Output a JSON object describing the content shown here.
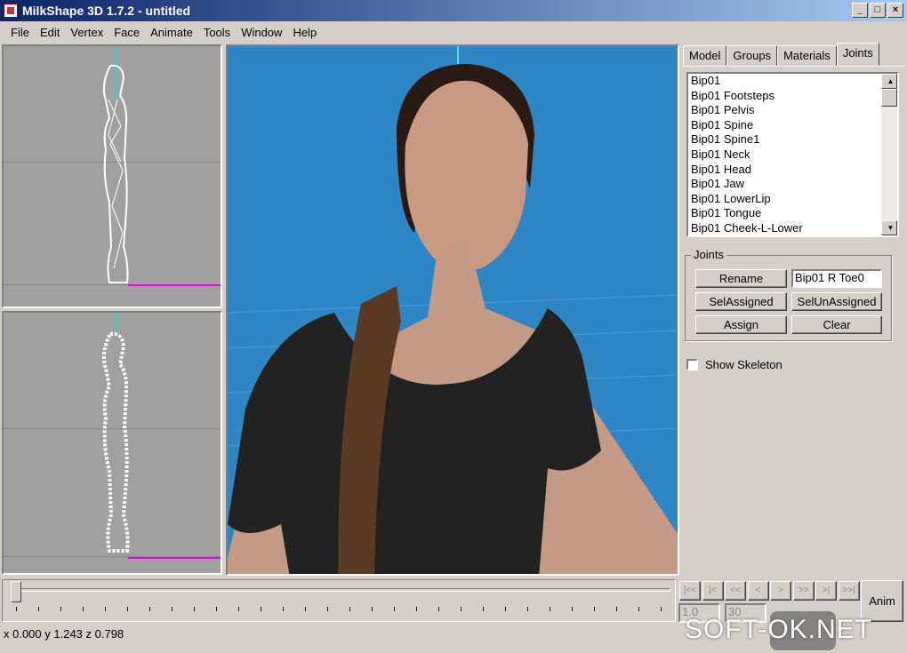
{
  "window": {
    "title": "MilkShape 3D 1.7.2 - untitled",
    "buttons": [
      "_",
      "□",
      "×"
    ]
  },
  "menu": [
    "File",
    "Edit",
    "Vertex",
    "Face",
    "Animate",
    "Tools",
    "Window",
    "Help"
  ],
  "tabs": [
    {
      "label": "Model"
    },
    {
      "label": "Groups"
    },
    {
      "label": "Materials"
    },
    {
      "label": "Joints",
      "active": true
    }
  ],
  "joints_list": [
    "Bip01",
    "Bip01 Footsteps",
    "Bip01 Pelvis",
    "Bip01 Spine",
    "Bip01 Spine1",
    "Bip01 Neck",
    "Bip01 Head",
    "Bip01 Jaw",
    "Bip01 LowerLip",
    "Bip01 Tongue",
    "Bip01 Cheek-L-Lower"
  ],
  "joints_group": {
    "title": "Joints",
    "rename": "Rename",
    "name_value": "Bip01 R Toe0",
    "sel_assigned": "SelAssigned",
    "sel_unassigned": "SelUnAssigned",
    "assign": "Assign",
    "clear": "Clear"
  },
  "show_skeleton": {
    "label": "Show Skeleton",
    "checked": false
  },
  "anim": {
    "buttons": [
      "|<<",
      "|<",
      "<<",
      "<",
      ">",
      ">>",
      ">|",
      ">>|"
    ],
    "start_frame": "1.0",
    "end_frame": "30",
    "anim_label": "Anim",
    "slider_position": 0
  },
  "status": {
    "coords": "x 0.000 y 1.243 z 0.798"
  },
  "watermark": "SOFT-OK.NET"
}
